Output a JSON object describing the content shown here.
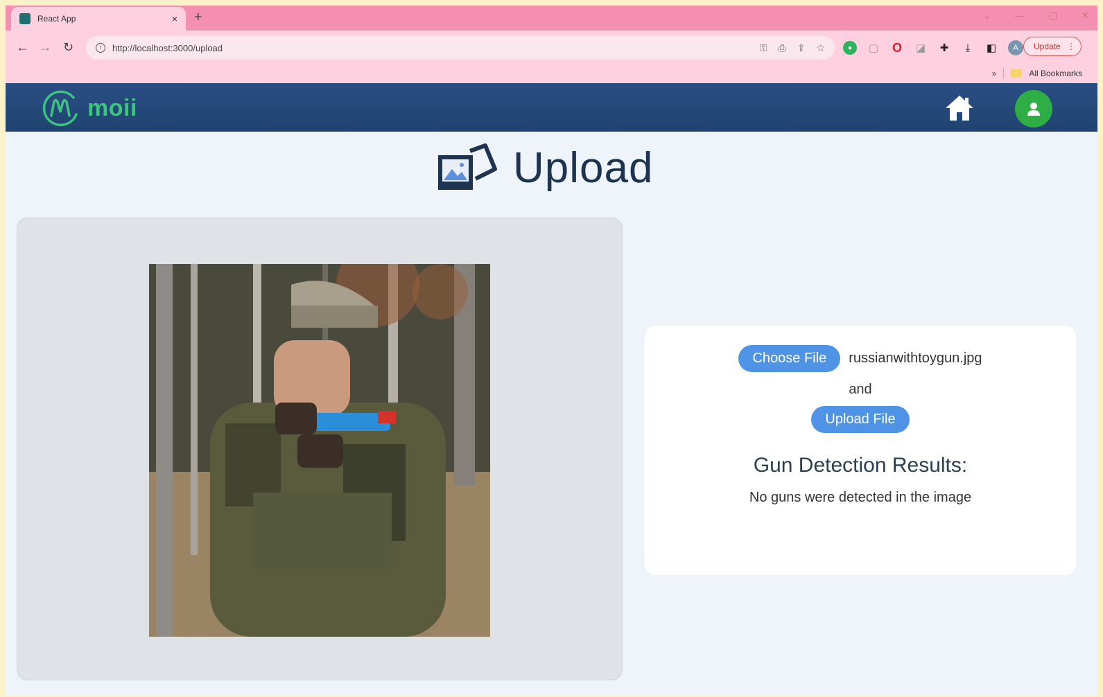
{
  "browser": {
    "tab_title": "React App",
    "tab_close": "×",
    "new_tab": "+",
    "url": "http://localhost:3000/upload",
    "update_label": "Update",
    "bookmarks_label": "All Bookmarks"
  },
  "header": {
    "logo_text": "moii"
  },
  "page": {
    "title": "Upload"
  },
  "upload_card": {
    "choose_label": "Choose File",
    "file_name": "russianwithtoygun.jpg",
    "and_text": "and",
    "upload_label": "Upload File",
    "results_title": "Gun Detection Results:",
    "results_text": "No guns were detected in the image"
  },
  "colors": {
    "header_bg": "#244a7a",
    "brand_green": "#3dc47e",
    "button_blue": "#4f93e6",
    "avatar_green": "#2fae46"
  }
}
